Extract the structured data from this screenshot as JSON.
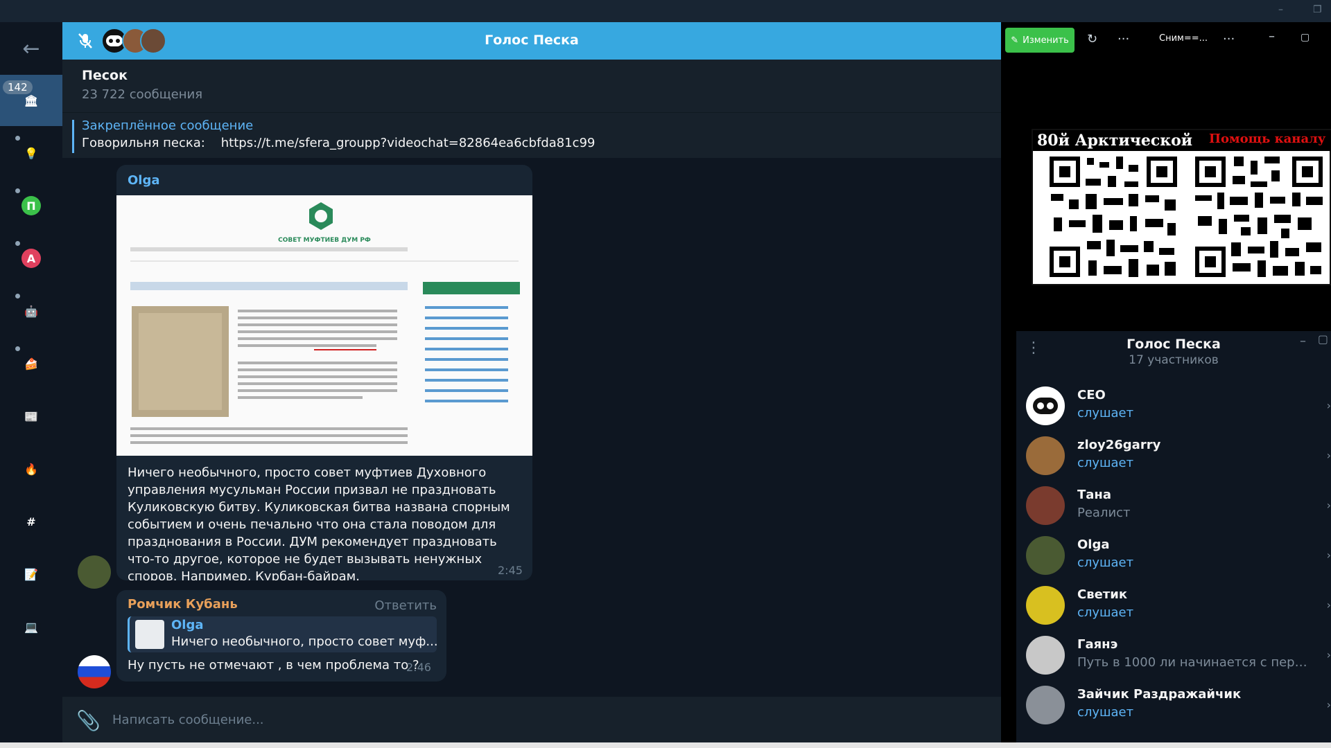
{
  "voice_chat_bar": {
    "title": "Голос Песка"
  },
  "chat": {
    "name": "Песок",
    "subtitle": "23 722 сообщения",
    "pinned": {
      "title": "Закреплённое сообщение",
      "text": "Говорильня песка:    https://t.me/sfera_groupp?videochat=82864ea6cbfda81c99"
    }
  },
  "folders": {
    "unread_badge": "142",
    "items": [
      {
        "name": "bank-icon",
        "glyph": "🏛",
        "color": "#2b5278"
      },
      {
        "name": "bulb-icon",
        "glyph": "💡",
        "color": "#0e1621"
      },
      {
        "name": "folder-p",
        "glyph": "П",
        "color": "#3bc14a"
      },
      {
        "name": "folder-a",
        "glyph": "A",
        "color": "#e0405e"
      },
      {
        "name": "robot-icon",
        "glyph": "🤖",
        "color": "#0e1621"
      },
      {
        "name": "cake-icon",
        "glyph": "🍰",
        "color": "#0e1621"
      },
      {
        "name": "news-icon",
        "glyph": "📰",
        "color": "#0e1621"
      },
      {
        "name": "fire-icon",
        "glyph": "🔥",
        "color": "#0e1621"
      },
      {
        "name": "hash-icon",
        "glyph": "#",
        "color": "#0e1621"
      },
      {
        "name": "note-icon",
        "glyph": "📝",
        "color": "#0e1621"
      },
      {
        "name": "laptop-icon",
        "glyph": "💻",
        "color": "#0e1621"
      }
    ]
  },
  "messages": {
    "first": {
      "sender": "Olga",
      "sender_color": "#5eb5f7",
      "photo_caption": "СОВЕТ МУФТИЕВ ДУМ РФ",
      "text": "Ничего необычного, просто совет муфтиев Духовного управления мусульман России призвал не праздновать Куликовскую битву. Куликовская битва названа спорным событием и очень печально что она стала поводом для празднования в России. ДУМ рекомендует праздновать что-то другое, которое не будет вызывать ненужных споров. Например, Курбан-байрам.",
      "time": "2:45"
    },
    "second": {
      "sender": "Ромчик Кубань",
      "sender_color": "#e8a05a",
      "action": "Ответить",
      "reply_name": "Olga",
      "reply_text": "Ничего необычного, просто совет муф...",
      "text": "Ну пусть не отмечают , в чем проблема то ?",
      "time": "2:46"
    }
  },
  "composer": {
    "placeholder": "Написать сообщение..."
  },
  "right_toolbar": {
    "edit_label": "Изменить",
    "label": "Сним==..."
  },
  "qr_panel": {
    "heading_left": "80й Арктической",
    "heading_right": "Помощь каналу"
  },
  "voice_panel": {
    "title": "Голос Песка",
    "subtitle": "17 участников",
    "participants": [
      {
        "name": "CEO",
        "status": "слушает",
        "active": true,
        "color": "#1a1a1a"
      },
      {
        "name": "zloy26garry",
        "status": "слушает",
        "active": true,
        "color": "#9a6b3a"
      },
      {
        "name": "Тана",
        "status": "Реалист",
        "active": false,
        "color": "#7a3b2e"
      },
      {
        "name": "Olga",
        "status": "слушает",
        "active": true,
        "color": "#4a5a32"
      },
      {
        "name": "Светик",
        "status": "слушает",
        "active": true,
        "color": "#d8c020"
      },
      {
        "name": "Гаянэ",
        "status": "Путь в 1000 ли начинается с перво...",
        "active": false,
        "color": "#c8c8c8"
      },
      {
        "name": "Зайчик Раздражайчик",
        "status": "слушает",
        "active": true,
        "color": "#8a9098"
      }
    ]
  }
}
